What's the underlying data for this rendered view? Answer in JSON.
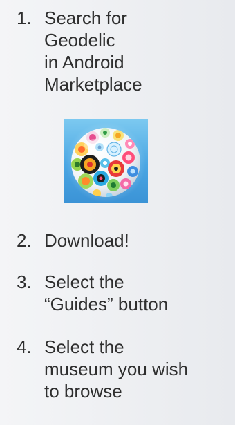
{
  "steps": [
    {
      "number": "1.",
      "text": "Search for\nGeodelic\nin Android\nMarketplace"
    },
    {
      "number": "2.",
      "text": "Download!"
    },
    {
      "number": "3.",
      "text": "Select the\n“Guides” button"
    },
    {
      "number": "4.",
      "text": "Select the\nmuseum you wish\nto browse"
    }
  ],
  "app_icon": {
    "icon_name": "geodelic-app-icon",
    "background_color": "#4aa6e3"
  },
  "colors": {
    "text": "#2f2f2f",
    "background": "#eef0f3"
  }
}
